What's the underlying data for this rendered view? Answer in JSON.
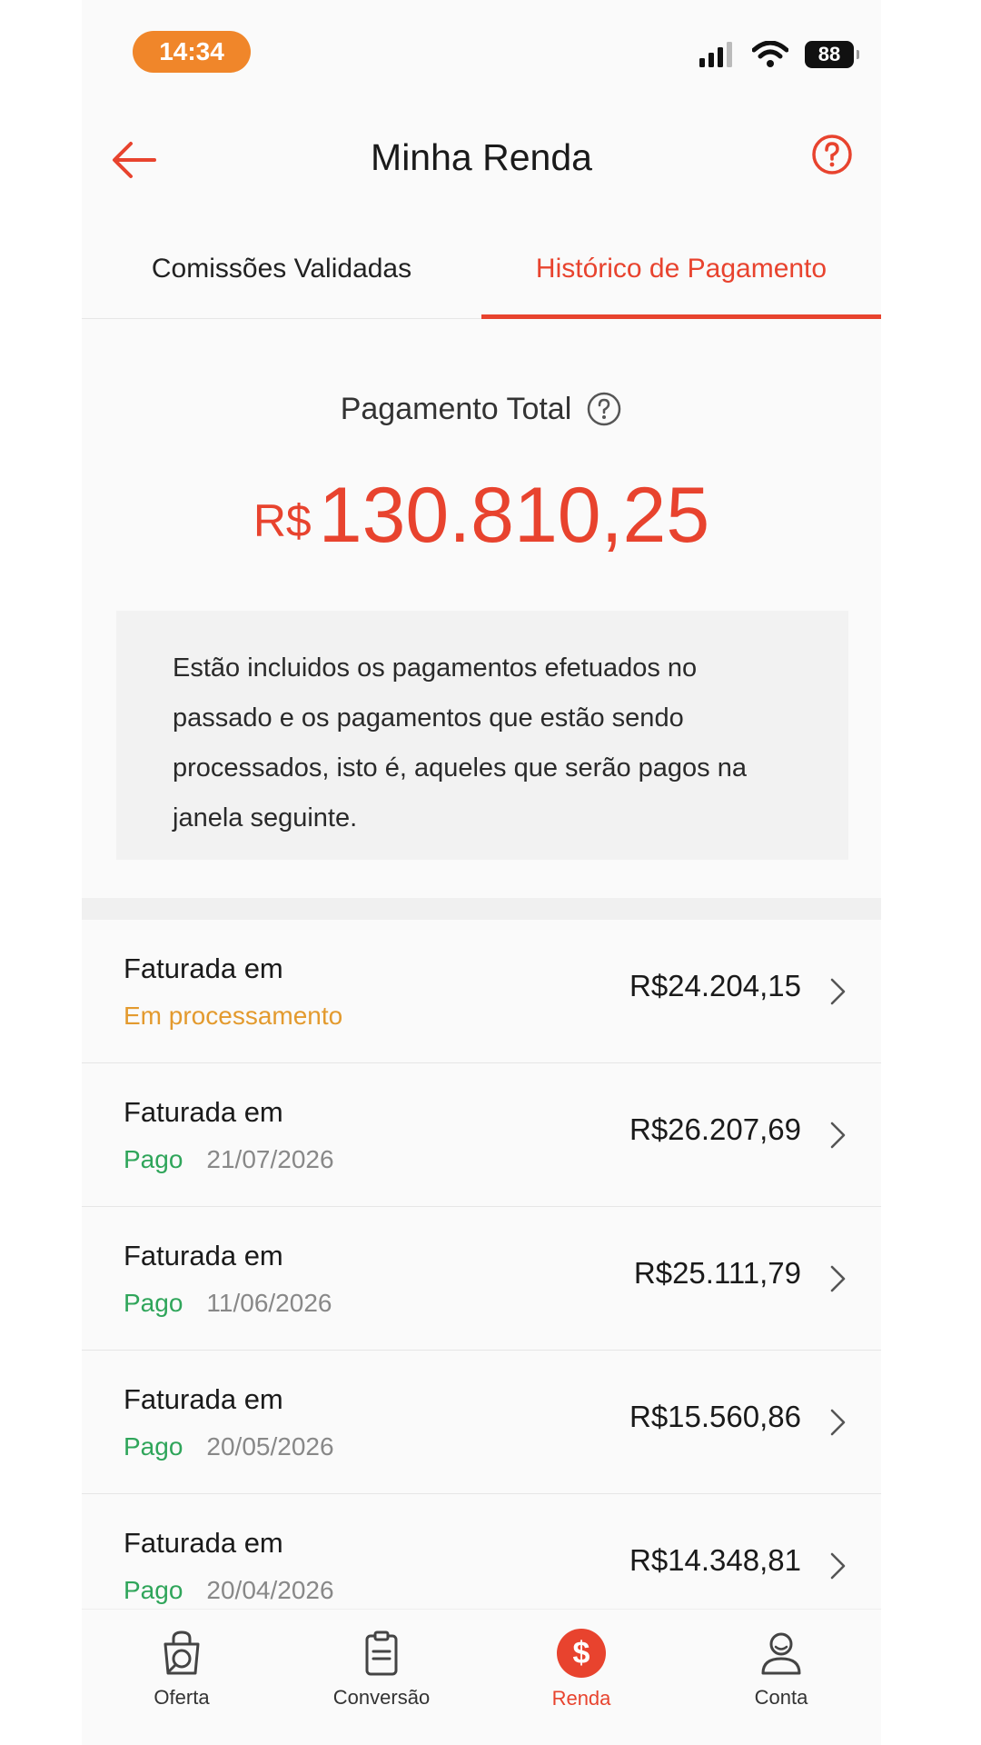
{
  "status_bar": {
    "time": "14:34",
    "battery": "88",
    "accent_color": "#f0862a"
  },
  "header": {
    "title": "Minha Renda",
    "back_icon": "arrow-left-icon",
    "help_icon": "question-circle-icon"
  },
  "tabs": [
    {
      "label": "Comissões Validadas",
      "active": false
    },
    {
      "label": "Histórico de Pagamento",
      "active": true
    }
  ],
  "total": {
    "label": "Pagamento Total",
    "currency": "R$",
    "amount": "130.810,25"
  },
  "info_text": "Estão incluidos os pagamentos efetuados no passado e os pagamentos que estão sendo processados, isto é, aqueles que serão pagos na janela seguinte.",
  "payments": [
    {
      "title": "Faturada em",
      "status": "Em processamento",
      "date": "",
      "amount": "R$24.204,15"
    },
    {
      "title": "Faturada em",
      "status": "Pago",
      "date": "21/07/2026",
      "amount": "R$26.207,69"
    },
    {
      "title": "Faturada em",
      "status": "Pago",
      "date": "11/06/2026",
      "amount": "R$25.111,79"
    },
    {
      "title": "Faturada em",
      "status": "Pago",
      "date": "20/05/2026",
      "amount": "R$15.560,86"
    },
    {
      "title": "Faturada em",
      "status": "Pago",
      "date": "20/04/2026",
      "amount": "R$14.348,81"
    }
  ],
  "bottom_nav": [
    {
      "label": "Oferta",
      "icon": "offer-bag-icon",
      "active": false
    },
    {
      "label": "Conversão",
      "icon": "clipboard-icon",
      "active": false
    },
    {
      "label": "Renda",
      "icon": "dollar-circle-icon",
      "active": true
    },
    {
      "label": "Conta",
      "icon": "user-icon",
      "active": false
    }
  ],
  "colors": {
    "accent": "#e8432e",
    "processing": "#e39a2e",
    "paid": "#2fa55a"
  }
}
